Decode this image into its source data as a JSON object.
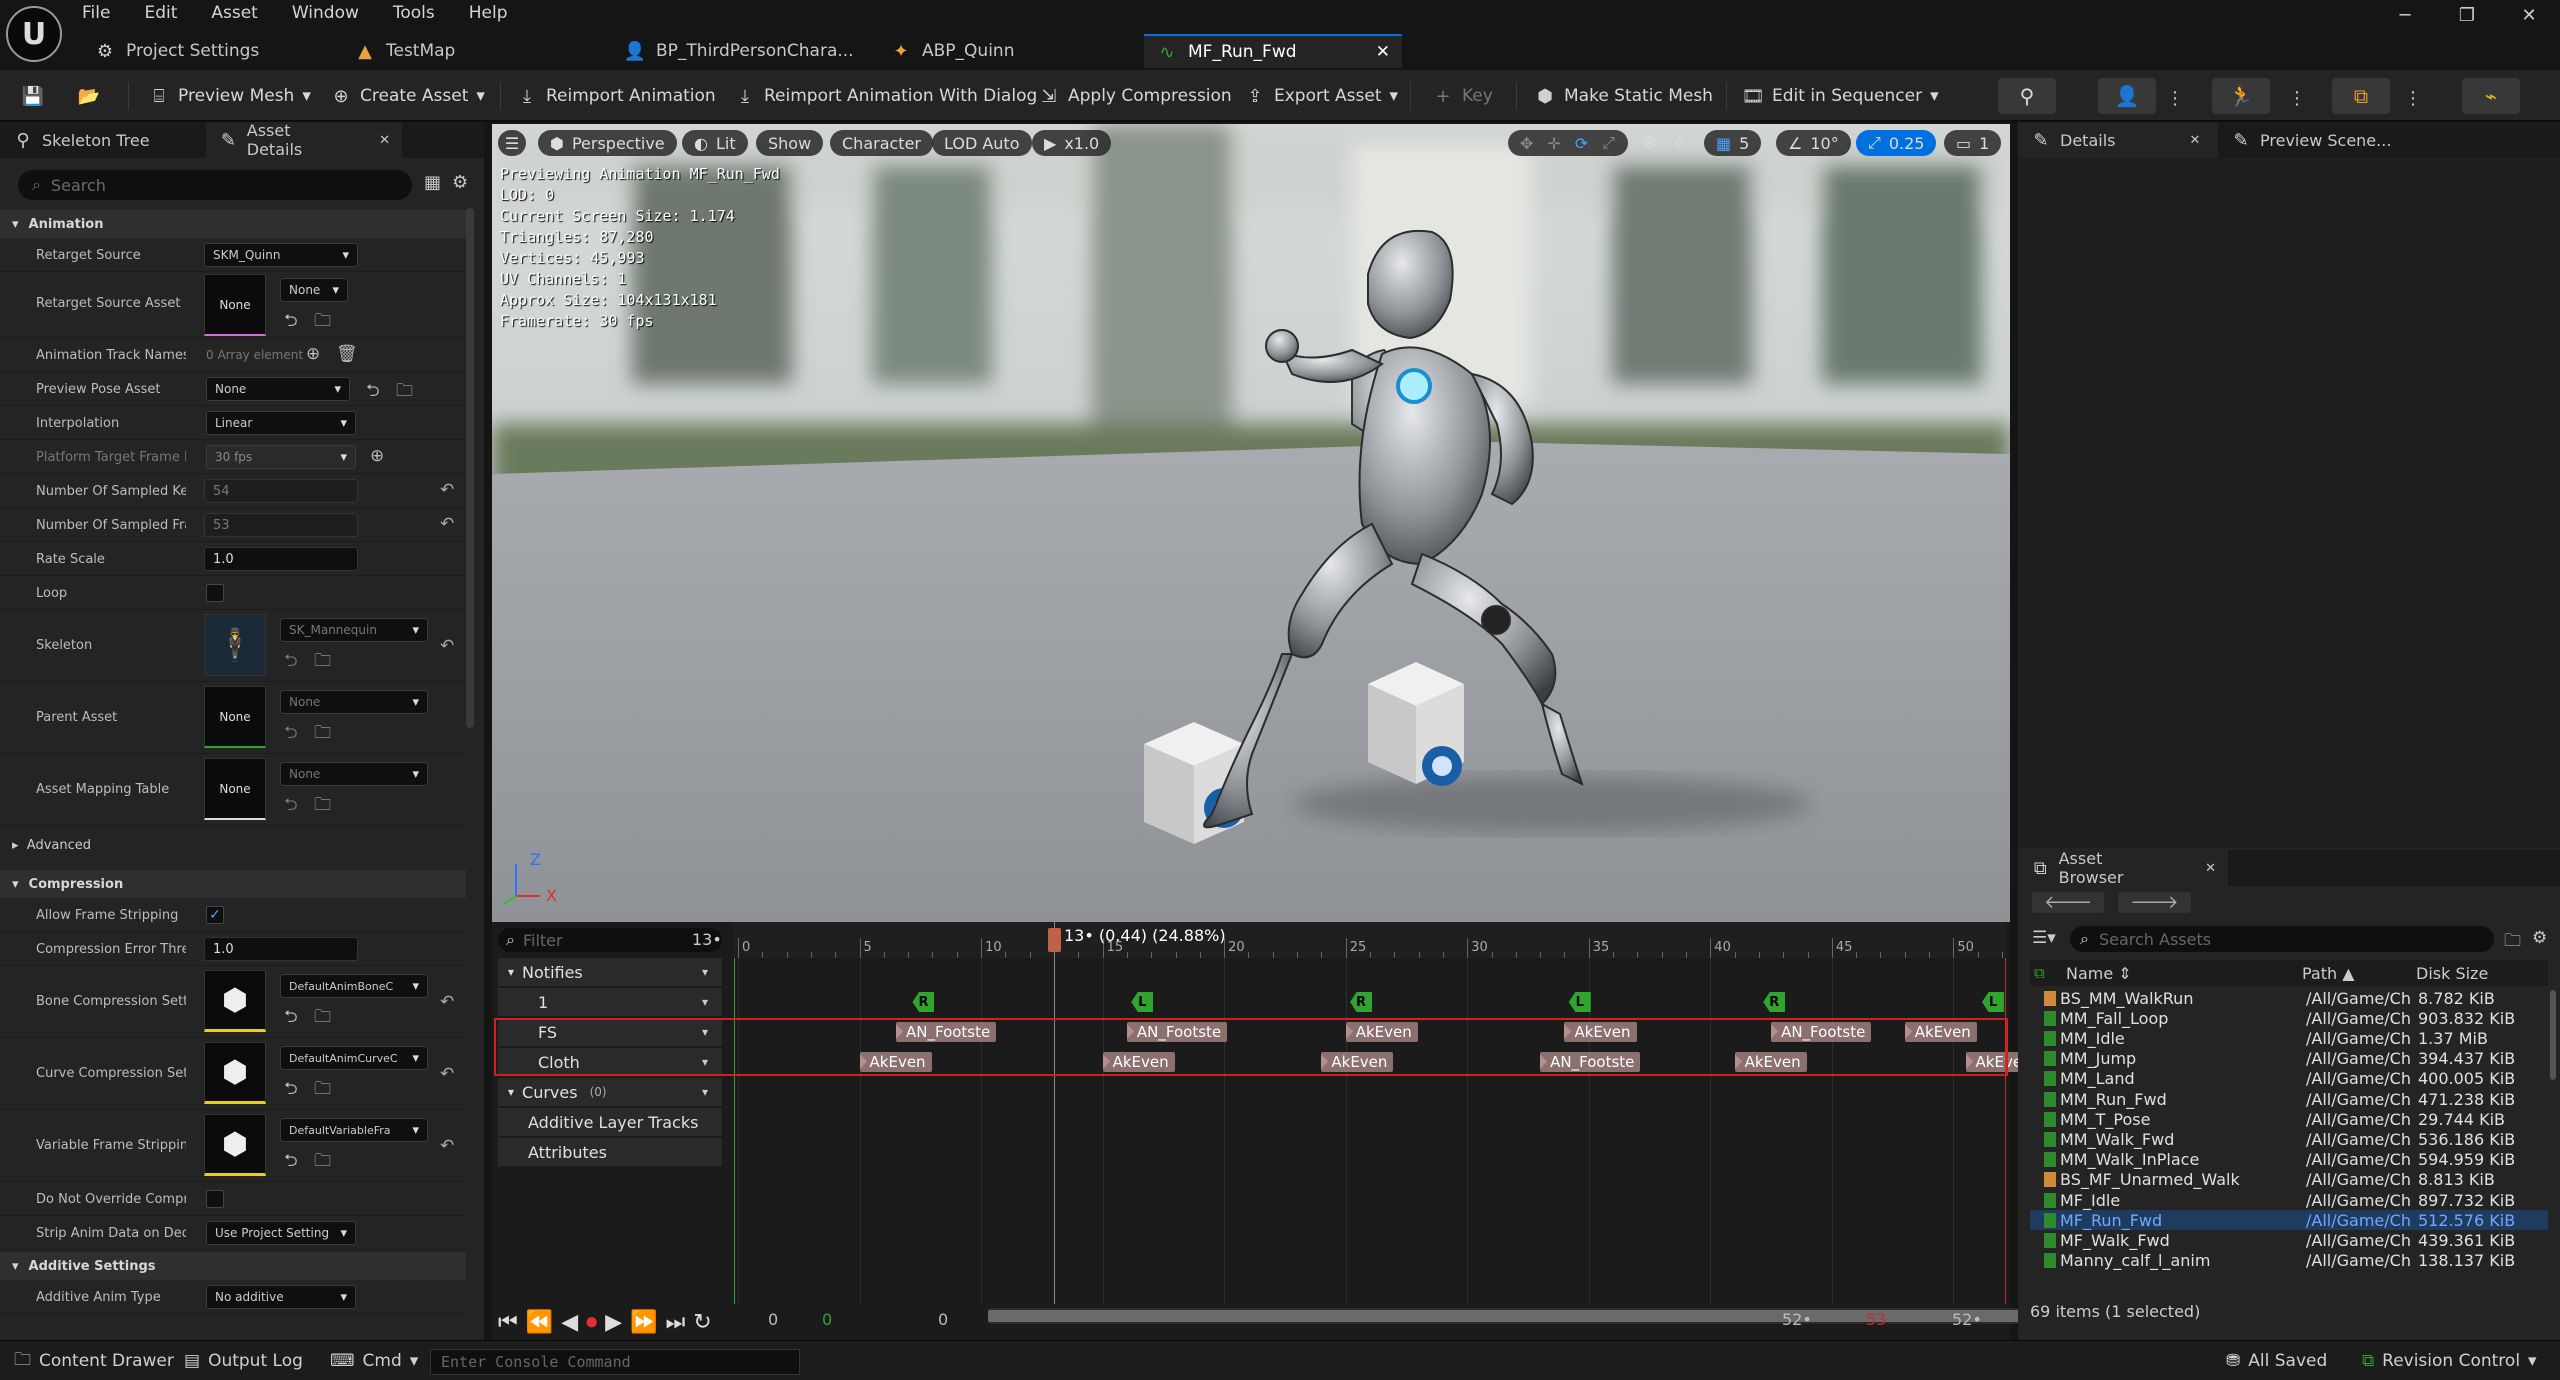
{
  "menu": [
    "File",
    "Edit",
    "Asset",
    "Window",
    "Tools",
    "Help"
  ],
  "tabs": [
    {
      "label": "Project Settings",
      "icon": "gear-icon"
    },
    {
      "label": "TestMap",
      "icon": "level-icon"
    },
    {
      "label": "BP_ThirdPersonChara...",
      "icon": "blueprint-icon"
    },
    {
      "label": "ABP_Quinn",
      "icon": "anim-blueprint-icon"
    },
    {
      "label": "MF_Run_Fwd",
      "icon": "animation-icon",
      "active": true
    }
  ],
  "toolbar": {
    "preview_mesh": "Preview Mesh",
    "create_asset": "Create Asset",
    "reimport": "Reimport Animation",
    "reimport_dialog": "Reimport Animation With Dialog",
    "apply_compression": "Apply Compression",
    "export_asset": "Export Asset",
    "key": "Key",
    "make_static_mesh": "Make Static Mesh",
    "edit_in_sequencer": "Edit in Sequencer"
  },
  "left_panel": {
    "tabs": [
      "Skeleton Tree",
      "Asset Details"
    ],
    "search_placeholder": "Search",
    "sections": {
      "animation": "Animation",
      "advanced": "Advanced",
      "compression": "Compression",
      "additive": "Additive Settings"
    },
    "props": {
      "retarget_source": {
        "label": "Retarget Source",
        "value": "SKM_Quinn"
      },
      "retarget_source_asset": {
        "label": "Retarget Source Asset",
        "value": "None",
        "dd": "None"
      },
      "anim_track_names": {
        "label": "Animation Track Names",
        "value": "0 Array element"
      },
      "preview_pose_asset": {
        "label": "Preview Pose Asset",
        "value": "None"
      },
      "interpolation": {
        "label": "Interpolation",
        "value": "Linear"
      },
      "platform_target_frame": {
        "label": "Platform Target Frame R...",
        "value": "30 fps"
      },
      "num_sampled_keys": {
        "label": "Number Of Sampled Keys",
        "value": "54"
      },
      "num_sampled_frames": {
        "label": "Number Of Sampled Fra...",
        "value": "53"
      },
      "rate_scale": {
        "label": "Rate Scale",
        "value": "1.0"
      },
      "loop": {
        "label": "Loop"
      },
      "skeleton": {
        "label": "Skeleton",
        "value": "SK_Mannequin"
      },
      "parent_asset": {
        "label": "Parent Asset",
        "value": "None",
        "dd": "None"
      },
      "asset_mapping_table": {
        "label": "Asset Mapping Table",
        "value": "None",
        "dd": "None"
      },
      "allow_frame_stripping": {
        "label": "Allow Frame Stripping"
      },
      "compression_error_threshold": {
        "label": "Compression Error Thre...",
        "value": "1.0"
      },
      "bone_compression": {
        "label": "Bone Compression Setti...",
        "value": "DefaultAnimBoneC"
      },
      "curve_compression": {
        "label": "Curve Compression Setti...",
        "value": "DefaultAnimCurveC"
      },
      "variable_frame_stripping": {
        "label": "Variable Frame Stripping...",
        "value": "DefaultVariableFra"
      },
      "do_not_override": {
        "label": "Do Not Override Compre..."
      },
      "strip_anim_data": {
        "label": "Strip Anim Data on Dedic...",
        "value": "Use Project Setting"
      },
      "additive_anim_type": {
        "label": "Additive Anim Type",
        "value": "No additive"
      }
    }
  },
  "viewport": {
    "menu_icon": "hamburger-icon",
    "perspective": "Perspective",
    "lit": "Lit",
    "show": "Show",
    "character": "Character",
    "lod": "LOD Auto",
    "speed": "x1.0",
    "grid_snap": "5",
    "rot_snap": "10°",
    "scale_snap": "0.25",
    "camera_speed": "1",
    "stats": [
      "Previewing Animation MF_Run_Fwd",
      "LOD: 0",
      "Current Screen Size: 1.174",
      "Triangles: 87,280",
      "Vertices: 45,993",
      "UV Channels: 1",
      "Approx Size: 104x131x181",
      "Framerate: 30 fps"
    ],
    "axis": {
      "z": "Z",
      "x": "X"
    }
  },
  "timeline": {
    "filter_placeholder": "Filter",
    "frame_count": "13•",
    "playhead_label": "13• (0.44) (24.88%)",
    "playhead_frame": 13,
    "total_frames": 52,
    "tracks": {
      "notifies": "Notifies",
      "track1": "1",
      "fs": "FS",
      "cloth": "Cloth",
      "curves": "Curves",
      "curves_count": "(0)",
      "additive": "Additive Layer Tracks",
      "attributes": "Attributes"
    },
    "ticks": [
      "0",
      "5",
      "10",
      "15",
      "20",
      "25",
      "30",
      "35",
      "40",
      "45",
      "50"
    ],
    "markers": [
      {
        "label": "R",
        "frame": 8
      },
      {
        "label": "L",
        "frame": 17
      },
      {
        "label": "R",
        "frame": 26
      },
      {
        "label": "L",
        "frame": 35
      },
      {
        "label": "R",
        "frame": 43
      },
      {
        "label": "L",
        "frame": 52
      }
    ],
    "fs_notifies": [
      {
        "label": "AN_Footste",
        "frame": 6.5
      },
      {
        "label": "AN_Footste",
        "frame": 16
      },
      {
        "label": "AkEven",
        "frame": 25
      },
      {
        "label": "AkEven",
        "frame": 34
      },
      {
        "label": "AN_Footste",
        "frame": 42.5
      },
      {
        "label": "AkEven",
        "frame": 48
      }
    ],
    "cloth_notifies": [
      {
        "label": "AkEven",
        "frame": 5
      },
      {
        "label": "AkEven",
        "frame": 15
      },
      {
        "label": "AkEven",
        "frame": 24
      },
      {
        "label": "AN_Footste",
        "frame": 33
      },
      {
        "label": "AkEven",
        "frame": 41
      },
      {
        "label": "AkEven",
        "frame": 50.5
      }
    ],
    "transport": {
      "start": "0",
      "green": "0",
      "current": "0",
      "end1": "52•",
      "red": "53",
      "end2": "52•"
    }
  },
  "right_panel": {
    "tabs": [
      "Details",
      "Preview Scene..."
    ]
  },
  "asset_browser": {
    "title": "Asset Browser",
    "search_placeholder": "Search Assets",
    "columns": {
      "name": "Name",
      "path": "Path",
      "size": "Disk Size"
    },
    "rows": [
      {
        "name": "BS_MM_WalkRun",
        "path": "/All/Game/Ch",
        "size": "8.782 KiB",
        "color": "#d08a3c"
      },
      {
        "name": "MM_Fall_Loop",
        "path": "/All/Game/Ch",
        "size": "903.832 KiB",
        "color": "#2d8a2d"
      },
      {
        "name": "MM_Idle",
        "path": "/All/Game/Ch",
        "size": "1.37 MiB",
        "color": "#2d8a2d"
      },
      {
        "name": "MM_Jump",
        "path": "/All/Game/Ch",
        "size": "394.437 KiB",
        "color": "#2d8a2d"
      },
      {
        "name": "MM_Land",
        "path": "/All/Game/Ch",
        "size": "400.005 KiB",
        "color": "#2d8a2d"
      },
      {
        "name": "MM_Run_Fwd",
        "path": "/All/Game/Ch",
        "size": "471.238 KiB",
        "color": "#2d8a2d"
      },
      {
        "name": "MM_T_Pose",
        "path": "/All/Game/Ch",
        "size": "29.744 KiB",
        "color": "#2d8a2d"
      },
      {
        "name": "MM_Walk_Fwd",
        "path": "/All/Game/Ch",
        "size": "536.186 KiB",
        "color": "#2d8a2d"
      },
      {
        "name": "MM_Walk_InPlace",
        "path": "/All/Game/Ch",
        "size": "594.959 KiB",
        "color": "#2d8a2d"
      },
      {
        "name": "BS_MF_Unarmed_WalkR",
        "path": "/All/Game/Ch",
        "size": "8.813 KiB",
        "color": "#d08a3c"
      },
      {
        "name": "MF_Idle",
        "path": "/All/Game/Ch",
        "size": "897.732 KiB",
        "color": "#2d8a2d"
      },
      {
        "name": "MF_Run_Fwd",
        "path": "/All/Game/Ch",
        "size": "512.576 KiB",
        "color": "#2d8a2d",
        "selected": true
      },
      {
        "name": "MF_Walk_Fwd",
        "path": "/All/Game/Ch",
        "size": "439.361 KiB",
        "color": "#2d8a2d"
      },
      {
        "name": "Manny_calf_l_anim",
        "path": "/All/Game/Ch",
        "size": "138.137 KiB",
        "color": "#2d8a2d"
      }
    ],
    "footer": "69 items (1 selected)"
  },
  "statusbar": {
    "content_drawer": "Content Drawer",
    "output_log": "Output Log",
    "cmd": "Cmd",
    "console_placeholder": "Enter Console Command",
    "all_saved": "All Saved",
    "revision_control": "Revision Control"
  },
  "colors": {
    "accent": "#0070e0",
    "notify_fill": "#8c6f6f",
    "marker": "#2fa52f",
    "selection_box": "#d02020"
  }
}
